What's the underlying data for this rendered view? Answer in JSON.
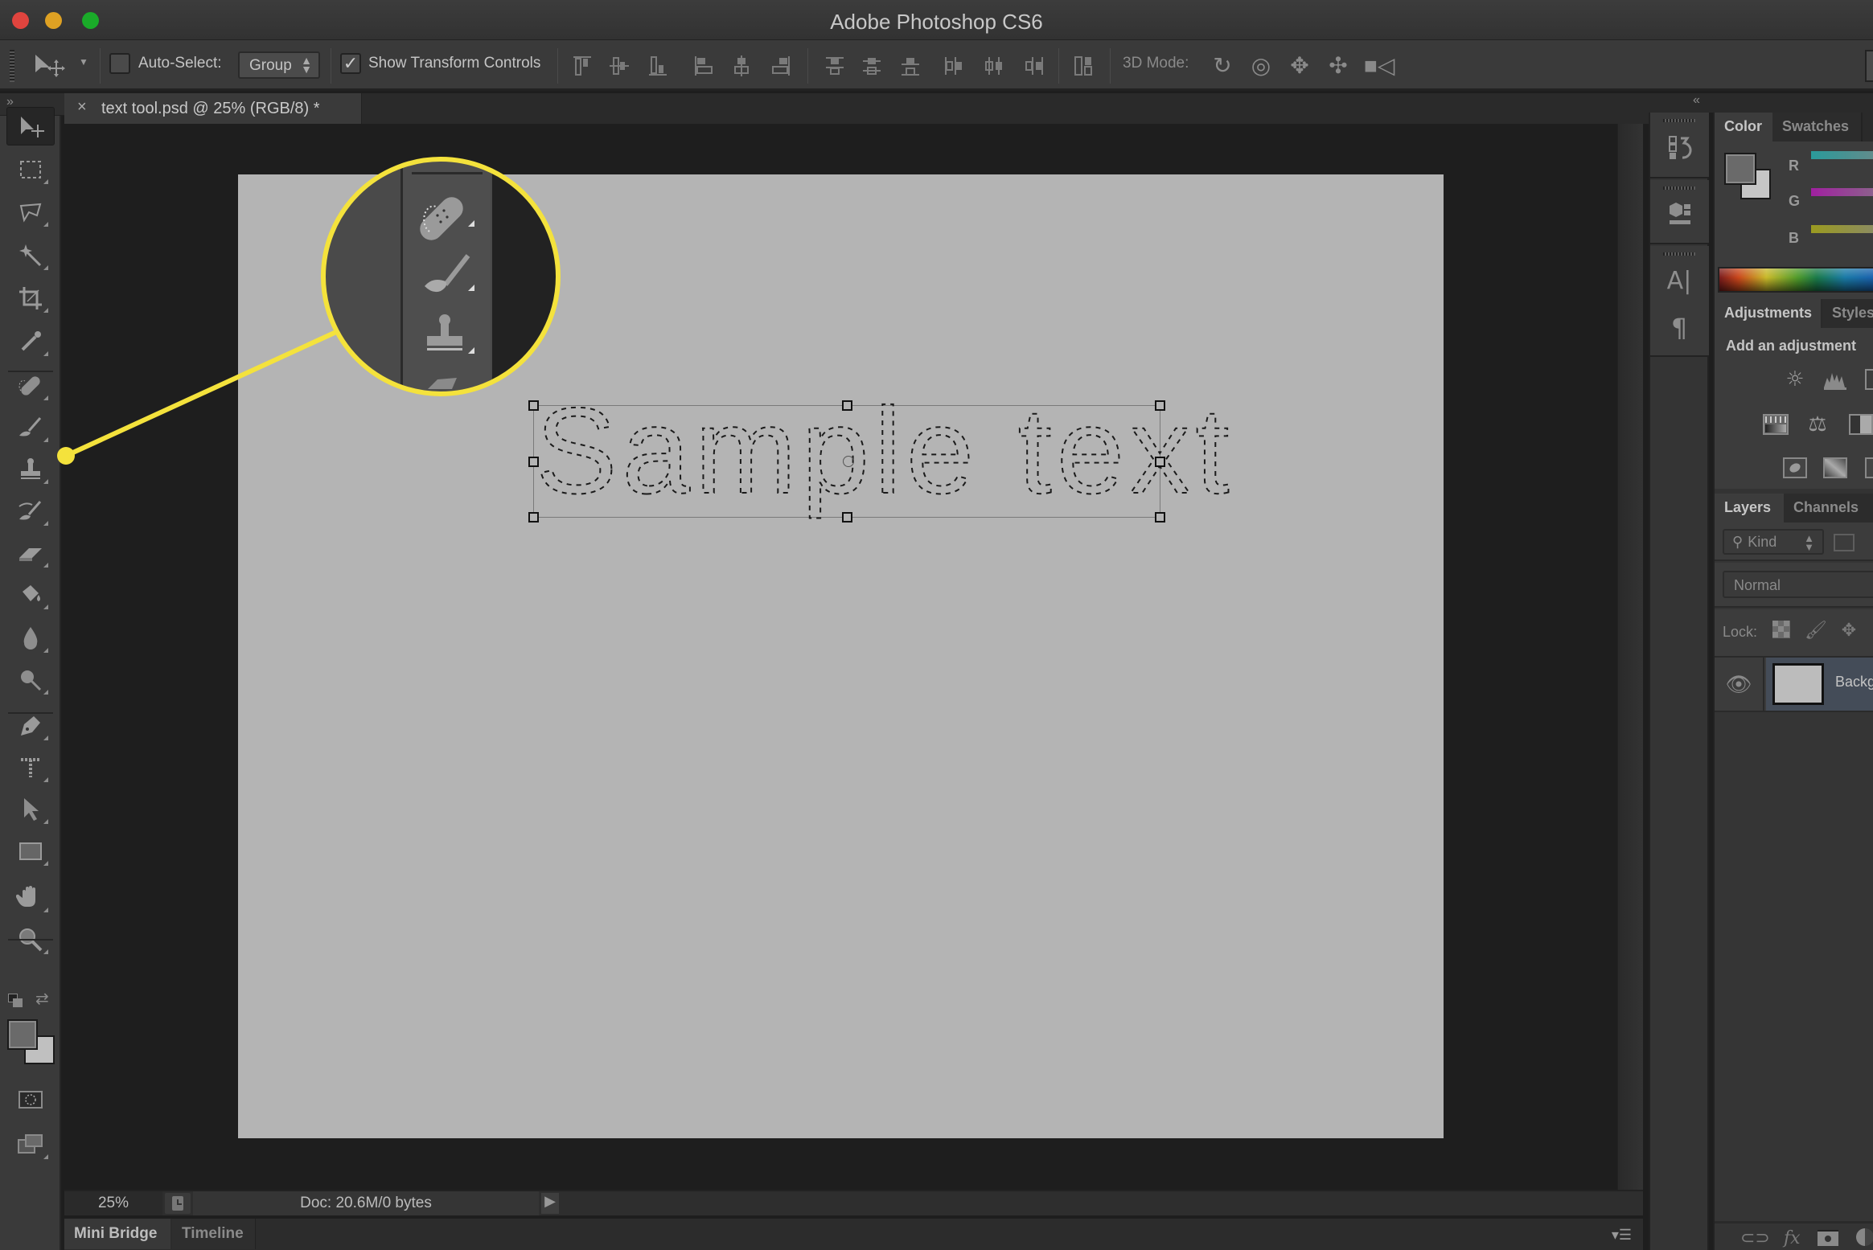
{
  "window": {
    "title": "Adobe Photoshop CS6"
  },
  "options_bar": {
    "auto_select_label": "Auto-Select:",
    "auto_select_checked": false,
    "auto_select_target": "Group",
    "show_transform_label": "Show Transform Controls",
    "show_transform_checked": true,
    "three_d_mode_label": "3D Mode:",
    "align_icons": [
      "align-top-edges-icon",
      "align-vertical-centers-icon",
      "align-bottom-edges-icon",
      "align-left-edges-icon",
      "align-horizontal-centers-icon",
      "align-right-edges-icon"
    ],
    "distribute_icons": [
      "distribute-top-edges-icon",
      "distribute-vertical-centers-icon",
      "distribute-bottom-edges-icon",
      "distribute-left-edges-icon",
      "distribute-horizontal-centers-icon",
      "distribute-right-edges-icon"
    ],
    "auto_align_icon": "auto-align-layers-icon",
    "three_d_icons": [
      "rotate-3d-icon",
      "roll-3d-icon",
      "drag-3d-icon",
      "slide-3d-icon",
      "scale-3d-icon"
    ]
  },
  "document": {
    "tab_label": "text tool.psd @ 25% (RGB/8) *",
    "close_glyph": "×",
    "canvas_text": "Sample text",
    "canvas_color": "#b4b4b4"
  },
  "toolbar": {
    "collapse_glyph": "»",
    "tools": [
      {
        "name": "move-tool",
        "active": true
      },
      {
        "name": "rectangular-marquee-tool"
      },
      {
        "name": "lasso-tool"
      },
      {
        "name": "magic-wand-tool"
      },
      {
        "name": "crop-tool"
      },
      {
        "name": "eyedropper-tool"
      },
      {
        "name": "spot-healing-brush-tool"
      },
      {
        "name": "brush-tool"
      },
      {
        "name": "clone-stamp-tool"
      },
      {
        "name": "history-brush-tool"
      },
      {
        "name": "eraser-tool"
      },
      {
        "name": "paint-bucket-tool"
      },
      {
        "name": "blur-tool"
      },
      {
        "name": "dodge-tool"
      },
      {
        "name": "pen-tool"
      },
      {
        "name": "horizontal-type-mask-tool"
      },
      {
        "name": "path-selection-tool"
      },
      {
        "name": "rectangle-tool"
      },
      {
        "name": "hand-tool"
      },
      {
        "name": "zoom-tool"
      }
    ],
    "foreground_color": "#6a6a6a",
    "background_color": "#c0c0c0"
  },
  "status_bar": {
    "zoom": "25%",
    "doc_info": "Doc: 20.6M/0 bytes",
    "arrow_glyph": "▶"
  },
  "bottom_panel": {
    "tabs": [
      "Mini Bridge",
      "Timeline"
    ],
    "active_tab": "Mini Bridge",
    "menu_glyph": "▾☰"
  },
  "right_dock": {
    "collapse_glyph": "«",
    "icons": [
      "history-icon",
      "3d-properties-icon",
      "character-icon",
      "paragraph-icon"
    ],
    "char_glyph": "A|",
    "para_glyph": "¶"
  },
  "color_panel": {
    "tabs": [
      "Color",
      "Swatches"
    ],
    "active_tab": "Color",
    "channels": [
      "R",
      "G",
      "B"
    ],
    "channel_colors": [
      "#2a9a9a",
      "#a020a0",
      "#9a9a20"
    ],
    "foreground_color": "#6a6a6a",
    "background_color": "#c6c6c6"
  },
  "adjustments_panel": {
    "tabs": [
      "Adjustments",
      "Styles"
    ],
    "active_tab": "Adjustments",
    "heading": "Add an adjustment",
    "icon_rows": [
      [
        "brightness-contrast-icon",
        "levels-icon",
        "curves-icon"
      ],
      [
        "hue-saturation-icon",
        "color-balance-icon",
        "black-white-icon"
      ],
      [
        "invert-icon",
        "gradient-map-icon",
        "selective-color-icon"
      ]
    ]
  },
  "layers_panel": {
    "tabs": [
      "Layers",
      "Channels"
    ],
    "active_tab": "Layers",
    "filter_kind": "Kind",
    "blend_mode": "Normal",
    "lock_label": "Lock:",
    "layers": [
      {
        "name": "Background",
        "visible": true,
        "selected": true
      }
    ],
    "footer_icons": [
      "link-layers-icon",
      "layer-style-icon",
      "add-mask-icon",
      "new-adjustment-icon"
    ]
  },
  "callout": {
    "color": "#f4e23c",
    "description": "Magnified view of toolbar: spot healing brush, brush, clone stamp"
  }
}
